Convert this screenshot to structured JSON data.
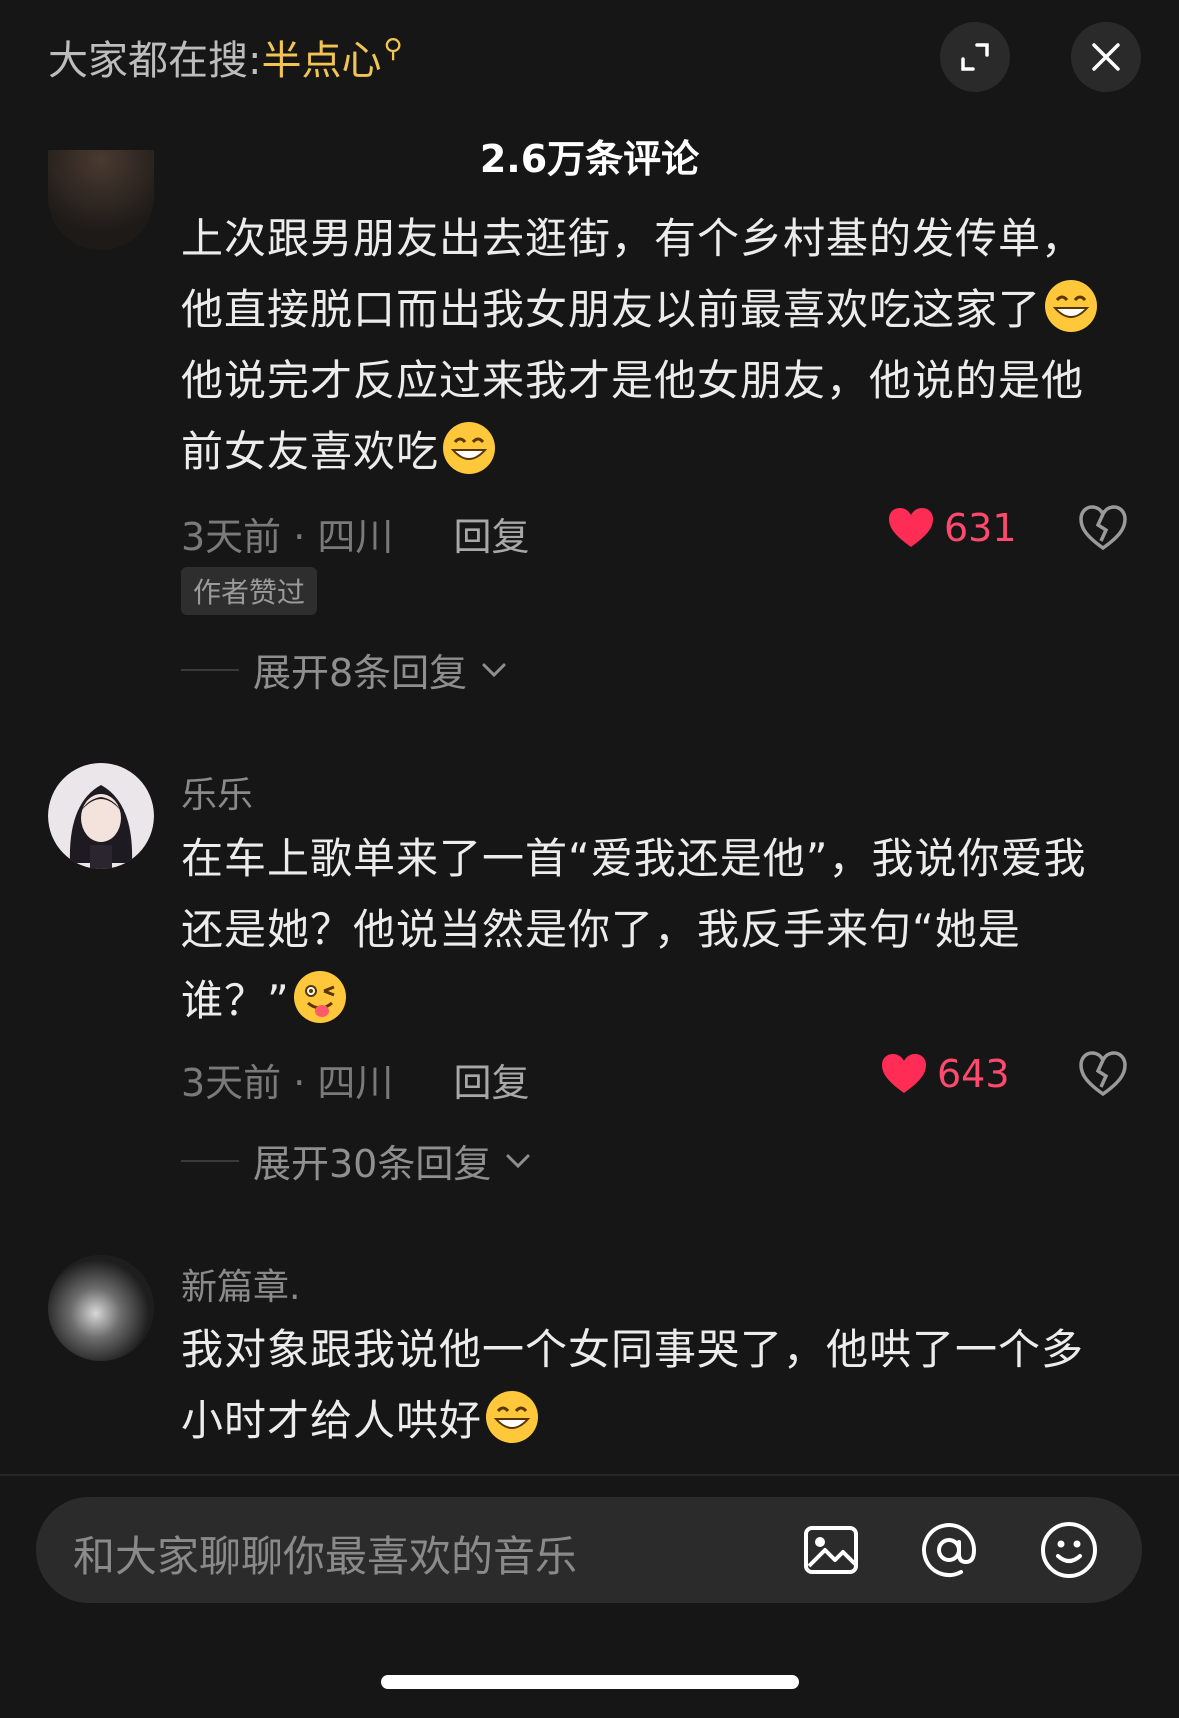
{
  "header": {
    "search_prefix": "大家都在搜:",
    "search_keyword": "半点心",
    "comment_count": "2.6万条评论"
  },
  "comments": [
    {
      "text_1": "上次跟男朋友出去逛街，有个乡村基的发传单，他直接脱口而出我女朋友以前最喜欢吃这家了",
      "text_2": "他说完才反应过来我才是他女朋友，他说的是他前女友喜欢吃",
      "time_location": "3天前 · 四川",
      "reply_label": "回复",
      "likes": "631",
      "badge": "作者赞过",
      "expand_label": "展开8条回复"
    },
    {
      "username": "乐乐",
      "text_1": "在车上歌单来了一首“爱我还是他”，我说你爱我还是她？他说当然是你了，我反手来句“她是谁？”",
      "time_location": "3天前 · 四川",
      "reply_label": "回复",
      "likes": "643",
      "expand_label": "展开30条回复"
    },
    {
      "username": "新篇章.",
      "text_1": "我对象跟我说他一个女同事哭了，他哄了一个多小时才给人哄好"
    }
  ],
  "input": {
    "placeholder": "和大家聊聊你最喜欢的音乐"
  },
  "colors": {
    "background": "#161616",
    "accent_keyword": "#f1c453",
    "like_red": "#ff4a6e"
  },
  "icons": [
    "expand-icon",
    "close-icon",
    "heart-icon",
    "dislike-heart-icon",
    "image-icon",
    "at-icon",
    "emoji-icon",
    "chevron-down-icon"
  ]
}
